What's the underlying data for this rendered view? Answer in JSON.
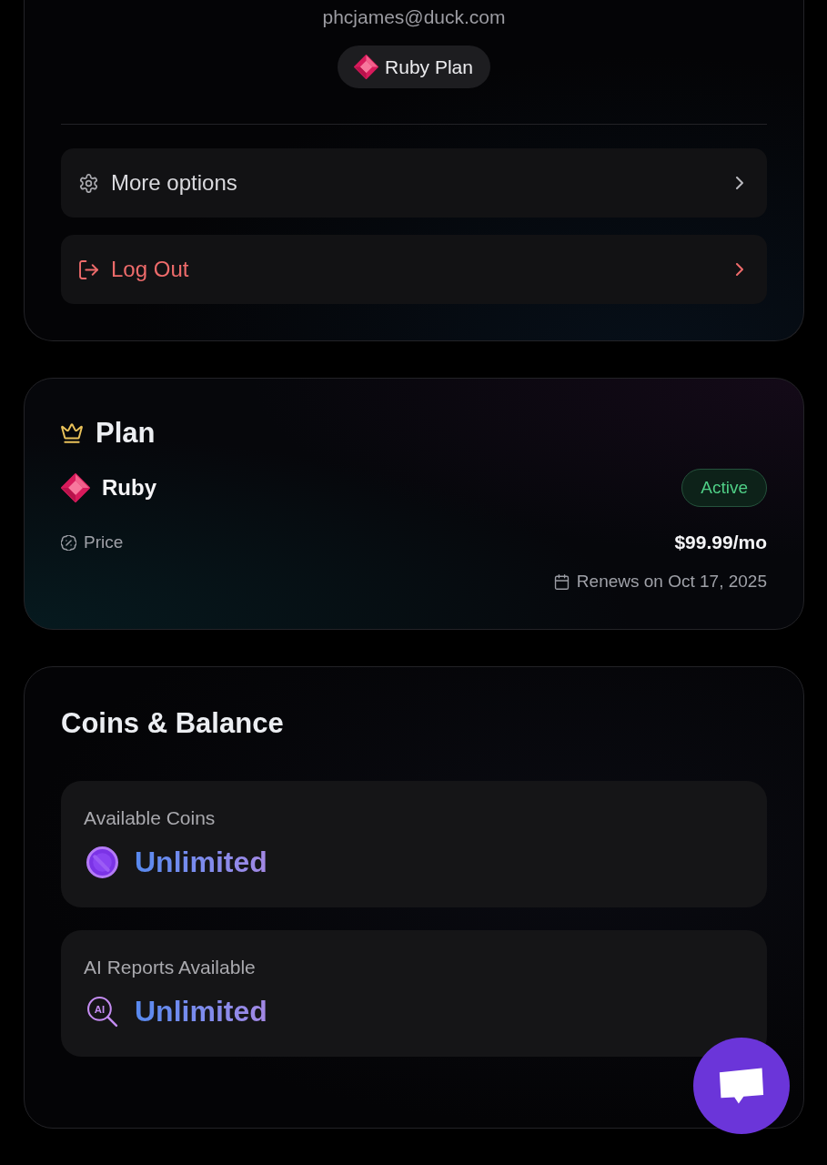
{
  "profile": {
    "email": "phcjames@duck.com",
    "plan_badge": "Ruby Plan"
  },
  "menu": [
    {
      "label": "More options",
      "kind": "settings"
    },
    {
      "label": "Log Out",
      "kind": "logout"
    }
  ],
  "plan": {
    "title": "Plan",
    "name": "Ruby",
    "status": "Active",
    "price_label": "Price",
    "price": "$99.99/mo",
    "renewal": "Renews on Oct 17, 2025"
  },
  "balance": {
    "title": "Coins & Balance",
    "items": [
      {
        "label": "Available Coins",
        "value": "Unlimited",
        "kind": "coins"
      },
      {
        "label": "AI Reports Available",
        "value": "Unlimited",
        "kind": "ai_reports",
        "icon_label": "AI"
      }
    ]
  }
}
